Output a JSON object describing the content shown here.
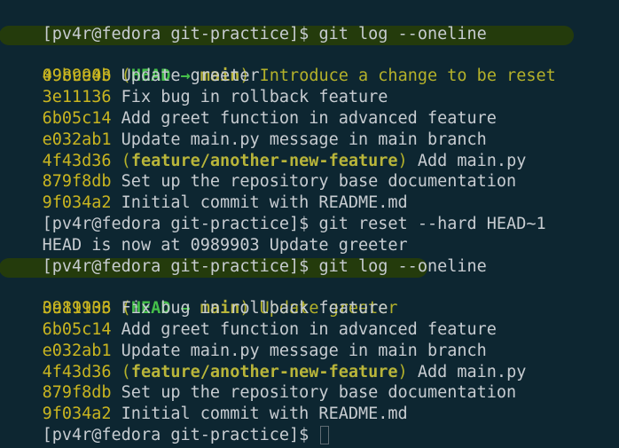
{
  "prompt": "[pv4r@fedora git-practice]$",
  "commands": {
    "log1": "git log --oneline",
    "reset": "git reset --hard HEAD~1",
    "log2": "git log --oneline"
  },
  "reset_output": "HEAD is now at 0989903 Update greeter",
  "refs": {
    "head": "HEAD",
    "arrow": "→",
    "main": "main",
    "feature": "feature/another-new-feature"
  },
  "log1": [
    {
      "hash": "49bce4b",
      "message": "Introduce a change to be reset"
    },
    {
      "hash": "0989903",
      "message": "Update greeter"
    },
    {
      "hash": "3e11136",
      "message": "Fix bug in rollback feature"
    },
    {
      "hash": "6b05c14",
      "message": "Add greet function in advanced feature"
    },
    {
      "hash": "e032ab1",
      "message": "Update main.py message in main branch"
    },
    {
      "hash": "4f43d36",
      "message": "Add main.py"
    },
    {
      "hash": "879f8db",
      "message": "Set up the repository base documentation"
    },
    {
      "hash": "9f034a2",
      "message": "Initial commit with README.md"
    }
  ],
  "log2": [
    {
      "hash": "0989903",
      "message": "Update greeter"
    },
    {
      "hash": "3e11136",
      "message": "Fix bug in rollback feature"
    },
    {
      "hash": "6b05c14",
      "message": "Add greet function in advanced feature"
    },
    {
      "hash": "e032ab1",
      "message": "Update main.py message in main branch"
    },
    {
      "hash": "4f43d36",
      "message": "Add main.py"
    },
    {
      "hash": "879f8db",
      "message": "Set up the repository base documentation"
    },
    {
      "hash": "9f034a2",
      "message": "Initial commit with README.md"
    }
  ]
}
